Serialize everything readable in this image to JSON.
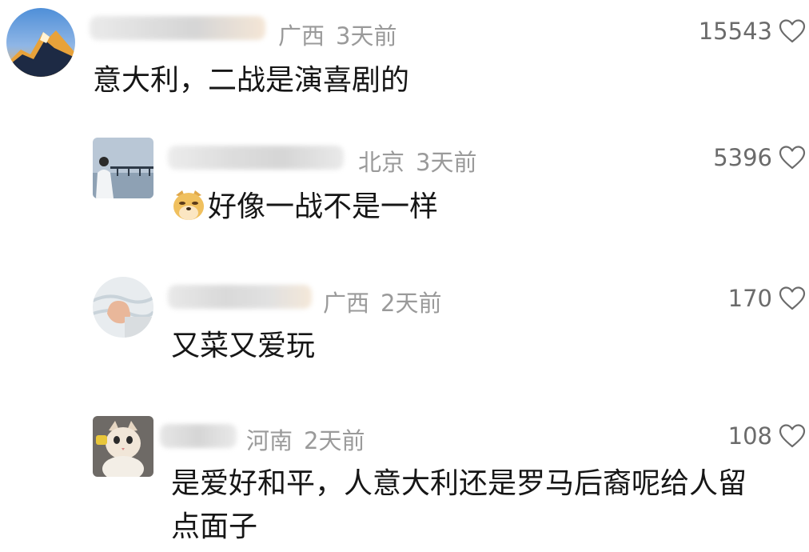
{
  "comments": [
    {
      "location": "广西",
      "time": "3天前",
      "text": "意大利，二战是演喜剧的",
      "likes": "15543",
      "avatar_icon": "mountain-sunset-avatar"
    },
    {
      "location": "北京",
      "time": "3天前",
      "emoji_icon": "doge-emoji-icon",
      "text": "好像一战不是一样",
      "likes": "5396",
      "avatar_icon": "person-by-pier-avatar"
    },
    {
      "location": "广西",
      "time": "2天前",
      "text": "又菜又爱玩",
      "likes": "170",
      "avatar_icon": "hand-avatar"
    },
    {
      "location": "河南",
      "time": "2天前",
      "text": "是爱好和平，人意大利还是罗马后裔呢给人留",
      "text_line2": "点面子",
      "likes": "108",
      "avatar_icon": "cat-avatar"
    }
  ],
  "colors": {
    "meta": "#9a9a9a",
    "text": "#161616",
    "likes": "#6b6b6b"
  }
}
